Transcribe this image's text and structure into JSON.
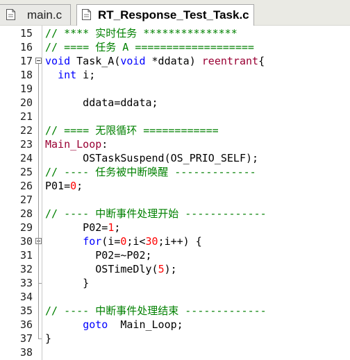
{
  "tabs": [
    {
      "label": "main.c",
      "active": false
    },
    {
      "label": "RT_Response_Test_Task.c",
      "active": true
    }
  ],
  "colors": {
    "comment": "#008000",
    "keyword": "#0000ff",
    "number": "#ff0000",
    "label": "#990033",
    "plain": "#000000"
  },
  "editor": {
    "lines": [
      {
        "num": "15",
        "tokens": [
          {
            "t": "// **** 实时任务 ***************",
            "c": "comment"
          }
        ]
      },
      {
        "num": "16",
        "tokens": [
          {
            "t": "// ==== 任务 A ===================",
            "c": "comment"
          }
        ]
      },
      {
        "num": "17",
        "fold": true,
        "tokens": [
          {
            "t": "void",
            "c": "keyword"
          },
          {
            "t": " Task_A(",
            "c": "plain"
          },
          {
            "t": "void",
            "c": "keyword"
          },
          {
            "t": " *ddata) ",
            "c": "plain"
          },
          {
            "t": "reentrant",
            "c": "label"
          },
          {
            "t": "{",
            "c": "plain"
          }
        ]
      },
      {
        "num": "18",
        "tokens": [
          {
            "t": "  ",
            "c": "plain"
          },
          {
            "t": "int",
            "c": "keyword"
          },
          {
            "t": " i;",
            "c": "plain"
          }
        ]
      },
      {
        "num": "19",
        "tokens": []
      },
      {
        "num": "20",
        "tokens": [
          {
            "t": "      ddata=ddata;",
            "c": "plain"
          }
        ]
      },
      {
        "num": "21",
        "tokens": []
      },
      {
        "num": "22",
        "tokens": [
          {
            "t": "// ==== 无限循环 ============",
            "c": "comment"
          }
        ]
      },
      {
        "num": "23",
        "tokens": [
          {
            "t": "Main_Loop",
            "c": "label"
          },
          {
            "t": ":",
            "c": "plain"
          }
        ]
      },
      {
        "num": "24",
        "tokens": [
          {
            "t": "      OSTaskSuspend(OS_PRIO_SELF);",
            "c": "plain"
          }
        ]
      },
      {
        "num": "25",
        "tokens": [
          {
            "t": "// ---- 任务被中断唤醒 -------------",
            "c": "comment"
          }
        ]
      },
      {
        "num": "26",
        "tokens": [
          {
            "t": "P01=",
            "c": "plain"
          },
          {
            "t": "0",
            "c": "number"
          },
          {
            "t": ";",
            "c": "plain"
          }
        ]
      },
      {
        "num": "27",
        "tokens": []
      },
      {
        "num": "28",
        "tokens": [
          {
            "t": "// ---- 中断事件处理开始 -------------",
            "c": "comment"
          }
        ]
      },
      {
        "num": "29",
        "tokens": [
          {
            "t": "      P02=",
            "c": "plain"
          },
          {
            "t": "1",
            "c": "number"
          },
          {
            "t": ";",
            "c": "plain"
          }
        ]
      },
      {
        "num": "30",
        "fold": true,
        "tokens": [
          {
            "t": "      ",
            "c": "plain"
          },
          {
            "t": "for",
            "c": "keyword"
          },
          {
            "t": "(i=",
            "c": "plain"
          },
          {
            "t": "0",
            "c": "number"
          },
          {
            "t": ";i<",
            "c": "plain"
          },
          {
            "t": "30",
            "c": "number"
          },
          {
            "t": ";i++) {",
            "c": "plain"
          }
        ]
      },
      {
        "num": "31",
        "tokens": [
          {
            "t": "        P02=~P02;",
            "c": "plain"
          }
        ]
      },
      {
        "num": "32",
        "tokens": [
          {
            "t": "        OSTimeDly(",
            "c": "plain"
          },
          {
            "t": "5",
            "c": "number"
          },
          {
            "t": ");",
            "c": "plain"
          }
        ]
      },
      {
        "num": "33",
        "tokens": [
          {
            "t": "      }",
            "c": "plain"
          }
        ]
      },
      {
        "num": "34",
        "tokens": []
      },
      {
        "num": "35",
        "tokens": [
          {
            "t": "// ---- 中断事件处理结束 -------------",
            "c": "comment"
          }
        ]
      },
      {
        "num": "36",
        "tokens": [
          {
            "t": "      ",
            "c": "plain"
          },
          {
            "t": "goto",
            "c": "keyword"
          },
          {
            "t": "  Main_Loop;",
            "c": "plain"
          }
        ]
      },
      {
        "num": "37",
        "tokens": [
          {
            "t": "}",
            "c": "plain"
          }
        ]
      },
      {
        "num": "38",
        "tokens": []
      }
    ]
  }
}
